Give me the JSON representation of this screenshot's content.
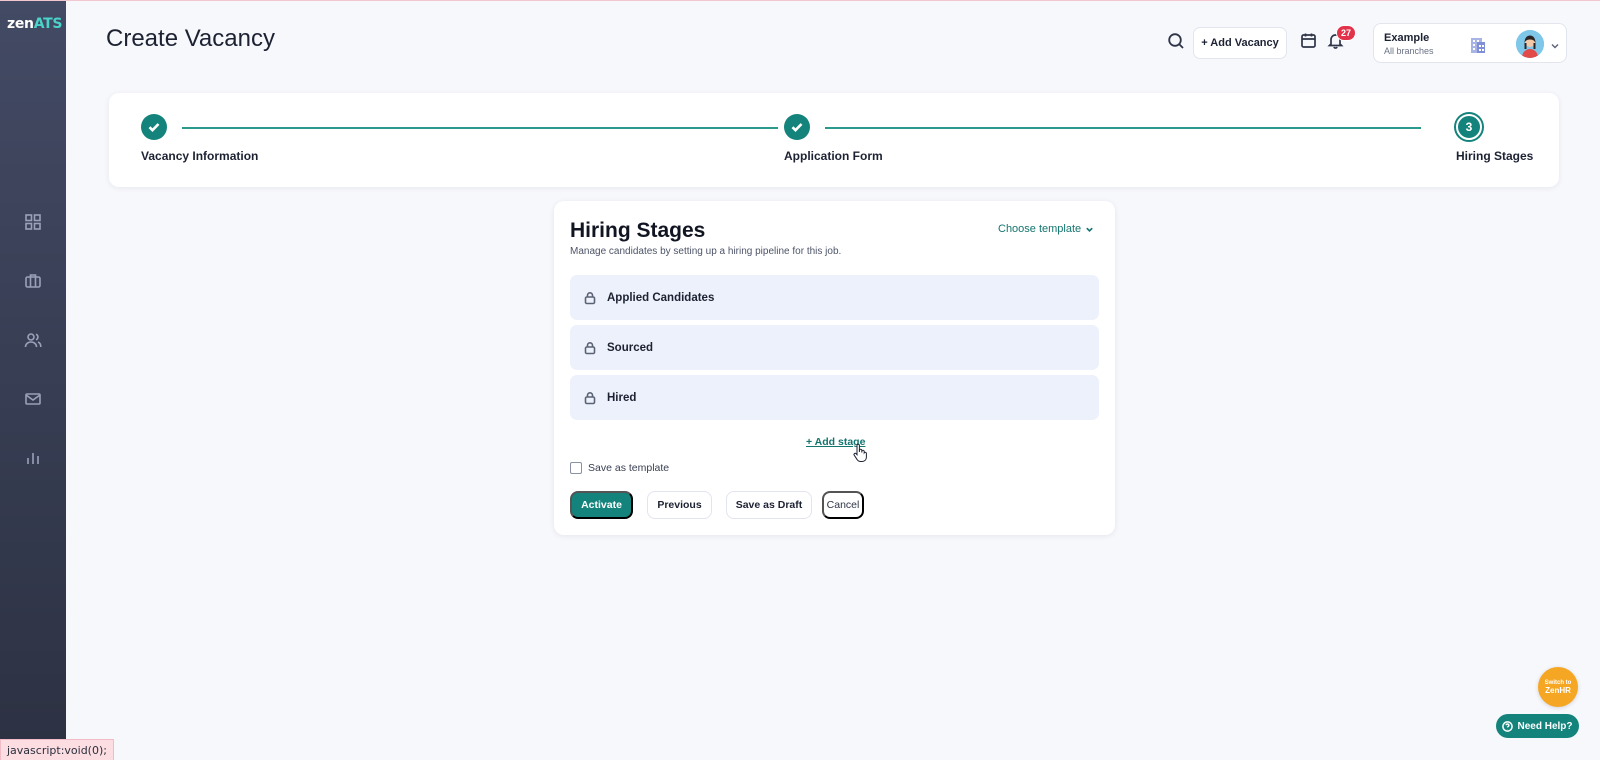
{
  "app": {
    "logo_main": "zen",
    "logo_accent": "ATS"
  },
  "sidebar": {
    "icons": [
      "dashboard-icon",
      "briefcase-icon",
      "users-icon",
      "mail-icon",
      "chart-icon"
    ]
  },
  "header": {
    "title": "Create Vacancy",
    "add_vacancy_label": "+ Add Vacancy",
    "notifications_count": "27",
    "account_name": "Example",
    "account_sub": "All branches"
  },
  "stepper": {
    "steps": [
      {
        "label": "Vacancy Information",
        "state": "done"
      },
      {
        "label": "Application Form",
        "state": "done"
      },
      {
        "label": "Hiring Stages",
        "state": "current",
        "number": "3"
      }
    ]
  },
  "card": {
    "title": "Hiring Stages",
    "subtitle": "Manage candidates by setting up a hiring pipeline for this job.",
    "choose_template": "Choose template",
    "stages": [
      "Applied Candidates",
      "Sourced",
      "Hired"
    ],
    "add_stage": "+ Add stage",
    "save_as_template": "Save as template",
    "buttons": {
      "activate": "Activate",
      "previous": "Previous",
      "draft": "Save as Draft",
      "cancel": "Cancel"
    }
  },
  "floating": {
    "switch_line1": "Switch to",
    "switch_line2": "ZenHR",
    "need_help": "Need Help?"
  },
  "status_bar": "javascript:void(0);",
  "colors": {
    "primary": "#14837c",
    "sidebar": "#3a4058",
    "badge": "#e2334a",
    "switch": "#f5a623"
  }
}
